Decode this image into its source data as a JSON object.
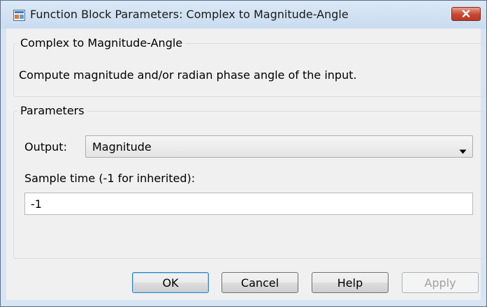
{
  "window": {
    "title": "Function Block Parameters: Complex to Magnitude-Angle"
  },
  "icons": {
    "app": "simulink-app-icon",
    "close": "close-icon",
    "dropdown": "chevron-down-icon"
  },
  "colors": {
    "title_bar": "#d3e3f4",
    "close_button": "#c9452f",
    "client_background": "#f0f0f0",
    "default_button_border": "#3c7fb1"
  },
  "block_description": {
    "legend": "Complex to Magnitude-Angle",
    "text": "Compute magnitude and/or radian phase angle of the input."
  },
  "parameters": {
    "legend": "Parameters",
    "output_label": "Output:",
    "output_value": "Magnitude",
    "sample_time_label": "Sample time (-1 for inherited):",
    "sample_time_value": "-1"
  },
  "buttons": {
    "ok": "OK",
    "cancel": "Cancel",
    "help": "Help",
    "apply": "Apply"
  }
}
